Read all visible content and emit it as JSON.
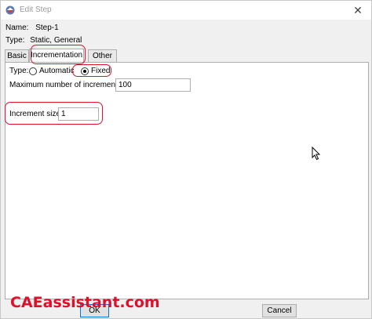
{
  "window": {
    "title": "Edit Step",
    "close_glyph": "✕"
  },
  "step": {
    "name_label": "Name:",
    "name_value": "Step-1",
    "type_label": "Type:",
    "type_value": "Static, General"
  },
  "tabs": [
    {
      "label": "Basic",
      "active": false
    },
    {
      "label": "Incrementation",
      "active": true
    },
    {
      "label": "Other",
      "active": false
    }
  ],
  "incrementation": {
    "type_label": "Type:",
    "options": [
      {
        "label": "Automatic",
        "selected": false
      },
      {
        "label": "Fixed",
        "selected": true
      }
    ],
    "max_increments_label": "Maximum number of increments:",
    "max_increments_value": "100",
    "increment_size_label": "Increment size:",
    "increment_size_value": "1"
  },
  "buttons": {
    "ok": "OK",
    "cancel": "Cancel"
  },
  "watermark": "CAEassistant.com",
  "icons": {
    "app": "abaqus-step-icon",
    "cursor": "mouse-pointer-icon"
  },
  "colors": {
    "highlight": "#e0102a",
    "window_bg": "#f0f0f0"
  }
}
